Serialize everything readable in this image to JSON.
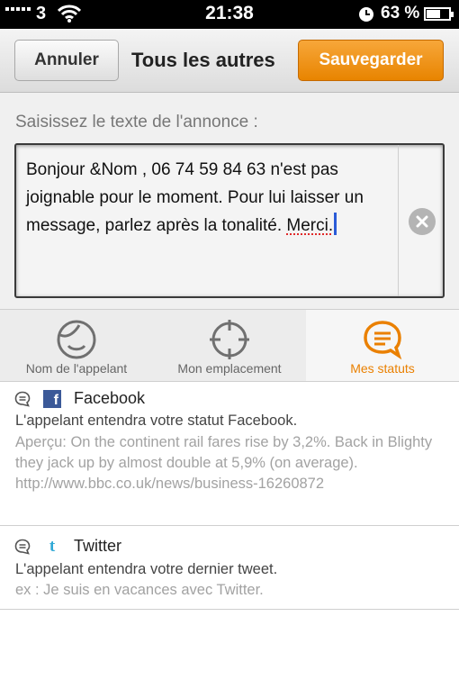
{
  "status_bar": {
    "carrier": "3",
    "time": "21:38",
    "battery": "63 %",
    "battery_level": 0.63
  },
  "navbar": {
    "cancel_label": "Annuler",
    "title": "Tous les autres",
    "save_label": "Sauvegarder"
  },
  "editor": {
    "prompt": "Saisissez le texte de l'annonce :",
    "text_main": "Bonjour &Nom , 06 74 59 84 63 n'est pas joignable pour le moment. Pour lui laisser un message, parlez après la tonalité. ",
    "text_flagged": "Merci."
  },
  "tabs": [
    {
      "label": "Nom de l'appelant",
      "icon": "face-icon",
      "active": false
    },
    {
      "label": "Mon emplacement",
      "icon": "crosshair-icon",
      "active": false
    },
    {
      "label": "Mes statuts",
      "icon": "speech-bubble-icon",
      "active": true
    }
  ],
  "items": [
    {
      "title": "Facebook",
      "line": "L'appelant entendra votre statut Facebook.",
      "preview": "Aperçu: On the continent rail fares rise by 3,2%. Back in Blighty they jack up by almost double at 5,9% (on average). http://www.bbc.co.uk/news/business-16260872"
    },
    {
      "title": "Twitter",
      "line": "L'appelant entendra votre dernier tweet.",
      "preview": "ex : Je suis en vacances avec Twitter."
    }
  ],
  "colors": {
    "accent": "#e88400",
    "active_tab_text": "#ea8000",
    "facebook": "#3b5998",
    "twitter": "#31a9d6"
  }
}
